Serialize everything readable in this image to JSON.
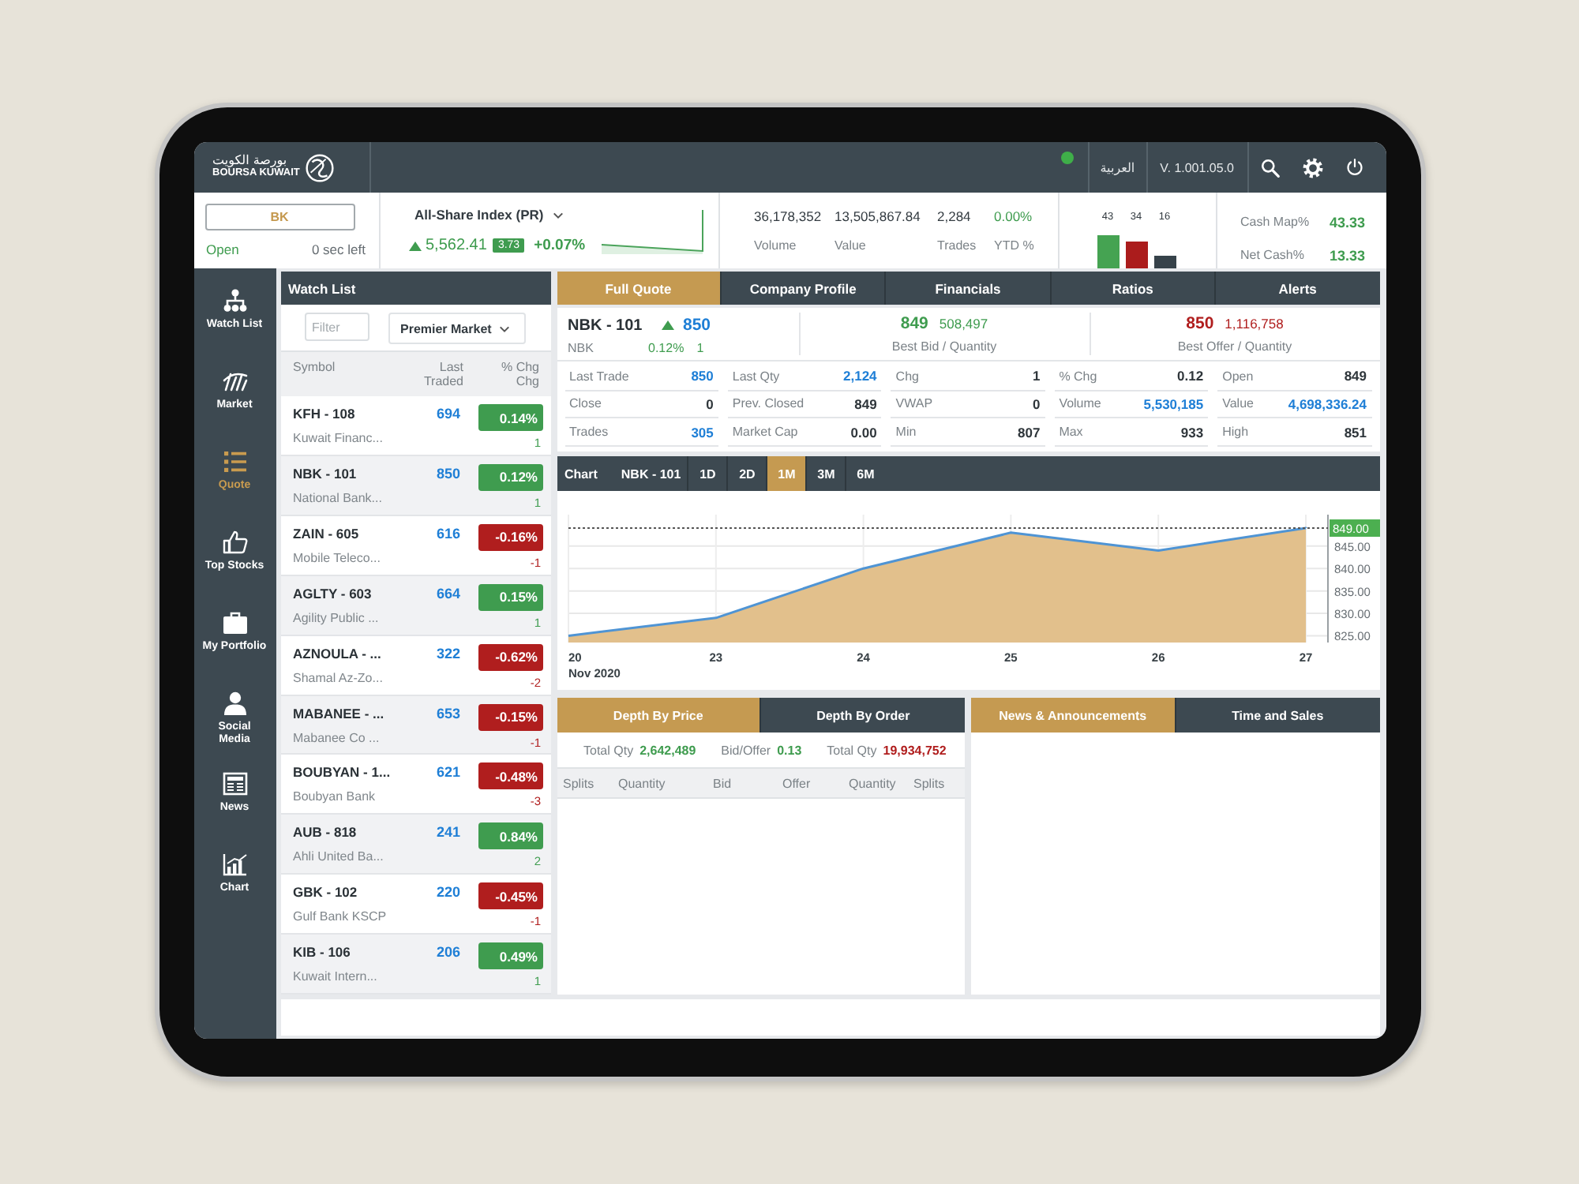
{
  "header": {
    "logo_arabic": "بورصة الكويت",
    "logo_latin": "BOURSA KUWAIT",
    "connected": true,
    "language": "العربية",
    "version": "V. 1.001.05.0"
  },
  "ticker": {
    "symbol_field": {
      "value": "BK"
    },
    "market_status": "Open",
    "countdown": "0 sec left",
    "index": {
      "name": "All-Share Index (PR)",
      "rising": true,
      "value": "5,562.41",
      "change": "3.73",
      "change_pct": "+0.07%"
    },
    "stats": [
      {
        "value": "36,178,352",
        "label": "Volume",
        "kind": "count"
      },
      {
        "value": "13,505,867.84",
        "label": "Value",
        "kind": "count"
      },
      {
        "value": "2,284",
        "label": "Trades",
        "kind": "count"
      },
      {
        "value": "0.00%",
        "label": "YTD %",
        "kind": "change"
      }
    ],
    "breadth": [
      {
        "count": "43",
        "color": "#45a352"
      },
      {
        "count": "34",
        "color": "#ab1c1c"
      },
      {
        "count": "16",
        "color": "#36424a"
      }
    ],
    "cash": [
      {
        "label": "Cash Map%",
        "value": "43.33"
      },
      {
        "label": "Net Cash%",
        "value": "13.33"
      }
    ]
  },
  "sidebar": {
    "items": [
      {
        "label": "Watch List",
        "selected": false
      },
      {
        "label": "Market",
        "selected": false
      },
      {
        "label": "Quote",
        "selected": true
      },
      {
        "label": "Top Stocks",
        "selected": false
      },
      {
        "label": "My Portfolio",
        "selected": false
      },
      {
        "label": "Social\nMedia",
        "selected": false
      },
      {
        "label": "News",
        "selected": false
      },
      {
        "label": "Chart",
        "selected": false
      }
    ]
  },
  "watchlist": {
    "title": "Watch List",
    "filter": {
      "placeholder": "Filter"
    },
    "market": "Premier Market",
    "columns": [
      "Symbol",
      "Last Traded",
      "% Chg",
      "Chg"
    ],
    "rows": [
      {
        "symbol": "KFH - 108",
        "name": "Kuwait Financ...",
        "last": "694",
        "change_pct": "0.14%",
        "change": "1",
        "rising": true
      },
      {
        "symbol": "NBK - 101",
        "name": "National Bank...",
        "last": "850",
        "change_pct": "0.12%",
        "change": "1",
        "rising": true
      },
      {
        "symbol": "ZAIN - 605",
        "name": "Mobile Teleco...",
        "last": "616",
        "change_pct": "-0.16%",
        "change": "-1",
        "rising": false
      },
      {
        "symbol": "AGLTY - 603",
        "name": "Agility Public ...",
        "last": "664",
        "change_pct": "0.15%",
        "change": "1",
        "rising": true
      },
      {
        "symbol": "AZNOULA - ...",
        "name": "Shamal Az-Zo...",
        "last": "322",
        "change_pct": "-0.62%",
        "change": "-2",
        "rising": false
      },
      {
        "symbol": "MABANEE - ...",
        "name": "Mabanee Co ...",
        "last": "653",
        "change_pct": "-0.15%",
        "change": "-1",
        "rising": false
      },
      {
        "symbol": "BOUBYAN - 1...",
        "name": "Boubyan Bank",
        "last": "621",
        "change_pct": "-0.48%",
        "change": "-3",
        "rising": false
      },
      {
        "symbol": "AUB - 818",
        "name": "Ahli United Ba...",
        "last": "241",
        "change_pct": "0.84%",
        "change": "2",
        "rising": true
      },
      {
        "symbol": "GBK - 102",
        "name": "Gulf Bank KSCP",
        "last": "220",
        "change_pct": "-0.45%",
        "change": "-1",
        "rising": false
      },
      {
        "symbol": "KIB - 106",
        "name": "Kuwait Intern...",
        "last": "206",
        "change_pct": "0.49%",
        "change": "1",
        "rising": true
      }
    ]
  },
  "quote": {
    "tabs": [
      {
        "label": "Full Quote",
        "selected": true
      },
      {
        "label": "Company Profile",
        "selected": false
      },
      {
        "label": "Financials",
        "selected": false
      },
      {
        "label": "Ratios",
        "selected": false
      },
      {
        "label": "Alerts",
        "selected": false
      }
    ],
    "symbol": "NBK - 101",
    "short_name": "NBK",
    "rising": true,
    "last": "850",
    "change_pct": "0.12%",
    "change": "1",
    "best_bid": {
      "price": "849",
      "quantity": "508,497",
      "label": "Best Bid / Quantity"
    },
    "best_offer": {
      "price": "850",
      "quantity": "1,116,758",
      "label": "Best Offer / Quantity"
    },
    "stats": [
      {
        "label": "Last Trade",
        "value": "850",
        "highlight": true
      },
      {
        "label": "Last Qty",
        "value": "2,124",
        "highlight": true
      },
      {
        "label": "Chg",
        "value": "1",
        "highlight": false
      },
      {
        "label": "% Chg",
        "value": "0.12",
        "highlight": false
      },
      {
        "label": "Open",
        "value": "849",
        "highlight": false
      },
      {
        "label": "Close",
        "value": "0",
        "highlight": false
      },
      {
        "label": "Prev. Closed",
        "value": "849",
        "highlight": false
      },
      {
        "label": "VWAP",
        "value": "0",
        "highlight": false
      },
      {
        "label": "Volume",
        "value": "5,530,185",
        "highlight": true
      },
      {
        "label": "Value",
        "value": "4,698,336.24",
        "highlight": true
      },
      {
        "label": "Trades",
        "value": "305",
        "highlight": true
      },
      {
        "label": "Market Cap",
        "value": "0.00",
        "highlight": false
      },
      {
        "label": "Min",
        "value": "807",
        "highlight": false
      },
      {
        "label": "Max",
        "value": "933",
        "highlight": false
      },
      {
        "label": "High",
        "value": "851",
        "highlight": false
      }
    ]
  },
  "chart": {
    "title": "Chart",
    "symbol": "NBK - 101",
    "periods": [
      {
        "label": "1D",
        "selected": false
      },
      {
        "label": "2D",
        "selected": false
      },
      {
        "label": "1M",
        "selected": true
      },
      {
        "label": "3M",
        "selected": false
      },
      {
        "label": "6M",
        "selected": false
      }
    ],
    "date_caption": "Nov 2020",
    "chart_data": {
      "type": "area",
      "categories": [
        "20",
        "23",
        "24",
        "25",
        "26",
        "27"
      ],
      "series": [
        {
          "color": "#e2c08c",
          "values": [
            825,
            829,
            840,
            848,
            844,
            849
          ]
        }
      ],
      "ylim": [
        823.5,
        852
      ],
      "yticks": [
        {
          "value": 825,
          "label": "825.00"
        },
        {
          "value": 830,
          "label": "830.00"
        },
        {
          "value": 835,
          "label": "835.00"
        },
        {
          "value": 840,
          "label": "840.00"
        },
        {
          "value": 845,
          "label": "845.00"
        }
      ],
      "grid": true,
      "ref_lines": [
        {
          "axis": "y",
          "value": 849,
          "label": "849.00"
        }
      ]
    }
  },
  "depth": {
    "tabs": [
      {
        "label": "Depth By Price",
        "selected": true
      },
      {
        "label": "Depth By Order",
        "selected": false
      }
    ],
    "totals": [
      {
        "label": "Total Qty",
        "value": "2,642,489",
        "color": "#3f9c4f"
      },
      {
        "label": "Bid/Offer",
        "value": "0.13",
        "color": "#3f9c4f"
      },
      {
        "label": "Total Qty",
        "value": "19,934,752",
        "color": "#b01e1e"
      }
    ],
    "columns": [
      "Splits",
      "Quantity",
      "Bid",
      "Offer",
      "Quantity",
      "Splits"
    ]
  },
  "news": {
    "tabs": [
      {
        "label": "News & Announcements",
        "selected": true
      },
      {
        "label": "Time and Sales",
        "selected": false
      }
    ]
  }
}
